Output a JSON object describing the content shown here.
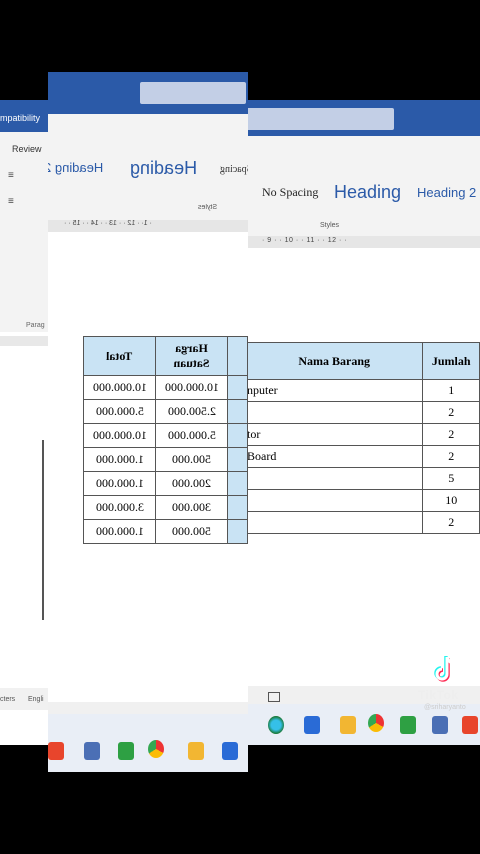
{
  "back_window": {
    "title_fragment": "mpatibility",
    "tab_fragment": "Review",
    "group_fragment": "Parag",
    "status_left": "cters",
    "status_lang": "Engli"
  },
  "main_window": {
    "styles": {
      "items": [
        "No Spacing",
        "Heading",
        "Heading 2"
      ],
      "group_label": "Styles"
    },
    "ruler_text": "· 9 · · 10 · · 11 · · 12 · ·",
    "table": {
      "headers": [
        "Nama Barang",
        "Jumlah"
      ],
      "rows": [
        [
          "nputer",
          "1"
        ],
        [
          "",
          "2"
        ],
        [
          "tor",
          "2"
        ],
        [
          " Board",
          "2"
        ],
        [
          "",
          "5"
        ],
        [
          "",
          "10"
        ],
        [
          "",
          "2"
        ]
      ]
    }
  },
  "flip_page": {
    "styles_mirrored": [
      "Heading 2",
      "Heading",
      "Spacing"
    ],
    "styles_label": "Styles",
    "ruler_text": "· 1· · 12 · · 13 · · 14 · · 15 · ·",
    "table": {
      "headers": [
        "Total",
        "Harga Satuan"
      ],
      "rows": [
        [
          "10.000.000",
          "10.000.000"
        ],
        [
          "5.000.000",
          "2.500.000"
        ],
        [
          "10.000.000",
          "5.000.000"
        ],
        [
          "1.000.000",
          "500.000"
        ],
        [
          "1.000.000",
          "200.000"
        ],
        [
          "3.000.000",
          "300.000"
        ],
        [
          "1.000.000",
          "500.000"
        ]
      ]
    }
  },
  "watermark": {
    "brand": "TikTok",
    "user": "@sriharyanto"
  },
  "colors": {
    "word_blue": "#2b5aa8",
    "table_header": "#c9e3f4"
  }
}
